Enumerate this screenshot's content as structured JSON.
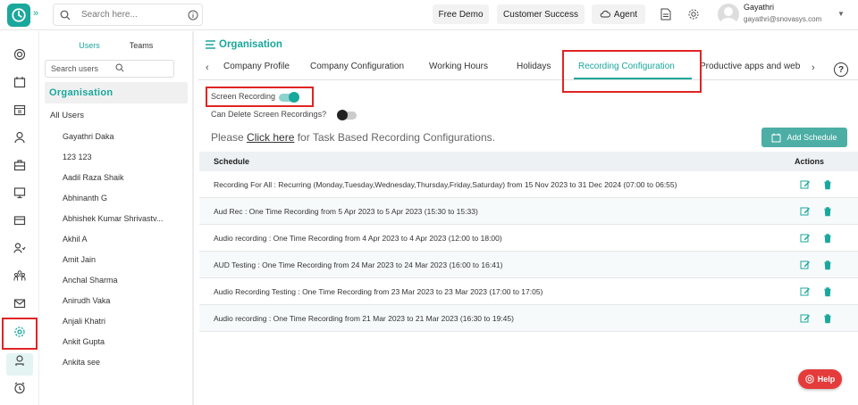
{
  "colors": {
    "accent": "#1aa79c",
    "highlight": "#e02424",
    "help": "#e53b3b"
  },
  "topbar": {
    "search_placeholder": "Search here...",
    "free_demo": "Free Demo",
    "customer_success": "Customer Success",
    "agent": "Agent",
    "user_name": "Gayathri",
    "user_email": "gayathri@snovasys.com"
  },
  "leftnav": {
    "icons": [
      "dashboard-icon",
      "calendar-icon",
      "timesheet-icon",
      "user-icon",
      "briefcase-icon",
      "monitor-icon",
      "card-icon",
      "people-icon",
      "team-icon",
      "mail-icon",
      "settings-icon",
      "badge-icon",
      "alarm-icon"
    ],
    "active": "settings-icon"
  },
  "userpanel": {
    "tab_users": "Users",
    "tab_teams": "Teams",
    "search_placeholder": "Search users",
    "org_title": "Organisation",
    "all_users": "All Users",
    "users": [
      "Gayathri Daka",
      "123 123",
      "Aadil Raza Shaik",
      "Abhinanth G",
      "Abhishek Kumar Shrivastv...",
      "Akhil A",
      "Amit Jain",
      "Anchal Sharma",
      "Anirudh Vaka",
      "Anjali Khatri",
      "Ankit Gupta",
      "Ankita see"
    ]
  },
  "main": {
    "title": "Organisation",
    "tabs": [
      "Company Profile",
      "Company Configuration",
      "Working Hours",
      "Holidays",
      "Recording Configuration",
      "Productive apps and web"
    ],
    "active_tab": "Recording Configuration",
    "screen_recording_label": "Screen Recording",
    "screen_recording_on": true,
    "can_delete_label": "Can Delete Screen Recordings?",
    "can_delete_on": false,
    "please_prefix": "Please ",
    "please_link": "Click here",
    "please_suffix": " for Task Based Recording Configurations.",
    "add_schedule": "Add Schedule",
    "col_schedule": "Schedule",
    "col_actions": "Actions",
    "rows": [
      "Recording For All : Recurring (Monday,Tuesday,Wednesday,Thursday,Friday,Saturday) from 15 Nov 2023 to 31 Dec 2024 (07:00 to 06:55)",
      "Aud Rec : One Time Recording from 5 Apr 2023 to 5 Apr 2023 (15:30 to 15:33)",
      "Audio recording : One Time Recording from 4 Apr 2023 to 4 Apr 2023 (12:00 to 18:00)",
      "AUD Testing : One Time Recording from 24 Mar 2023 to 24 Mar 2023 (16:00 to 16:41)",
      "Audio Recording Testing : One Time Recording from 23 Mar 2023 to 23 Mar 2023 (17:00 to 17:05)",
      "Audio recording : One Time Recording from 21 Mar 2023 to 21 Mar 2023 (16:30 to 19:45)"
    ]
  },
  "help_label": "Help"
}
